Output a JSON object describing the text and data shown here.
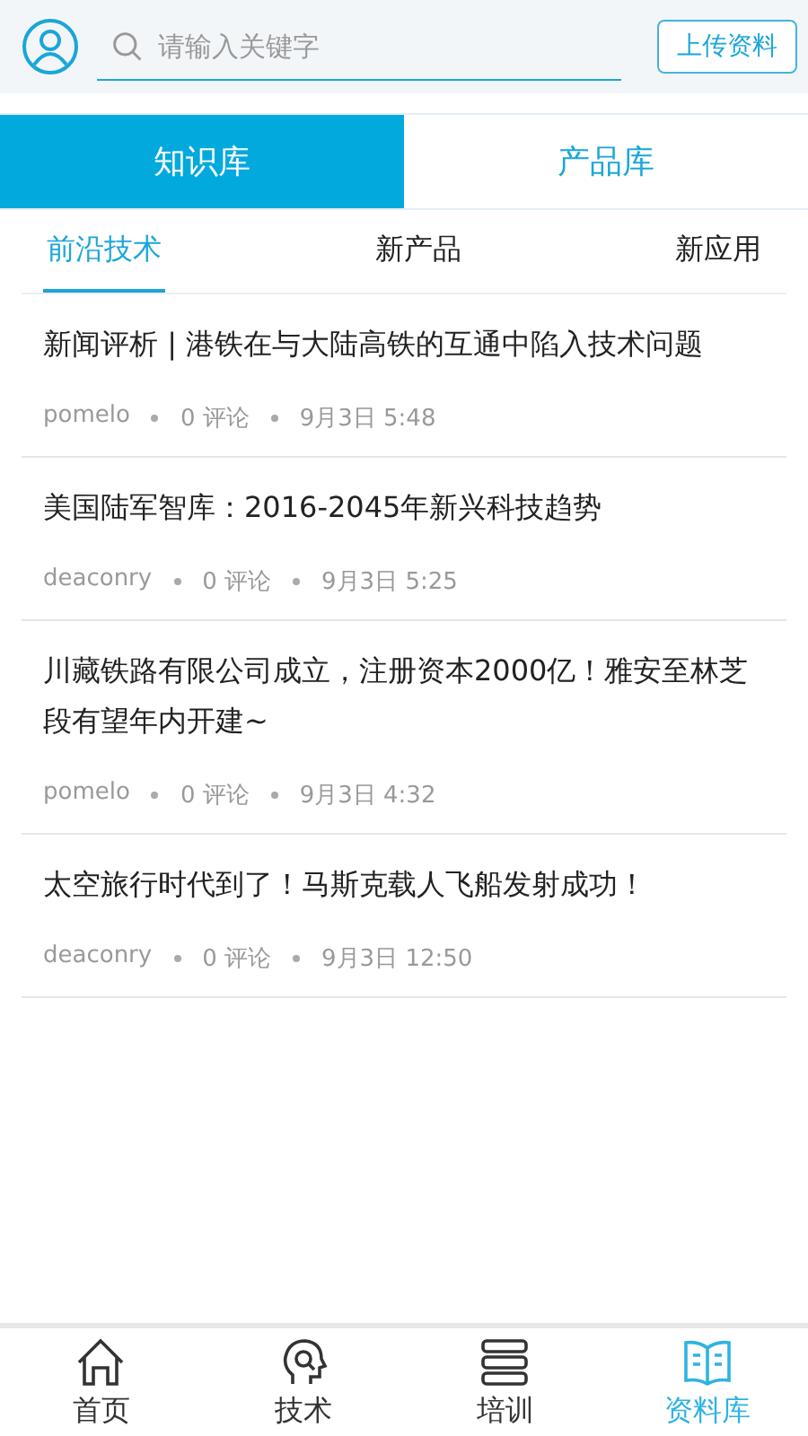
{
  "header": {
    "search": {
      "placeholder": "请输入关键字"
    },
    "upload_button": "上传资料"
  },
  "tabs": [
    {
      "label": "知识库",
      "selected": true
    },
    {
      "label": "产品库",
      "selected": false
    }
  ],
  "subtabs": [
    {
      "label": "前沿技术",
      "selected": true
    },
    {
      "label": "新产品",
      "selected": false
    },
    {
      "label": "新应用",
      "selected": false
    }
  ],
  "articles": [
    {
      "title": "新闻评析 | 港铁在与大陆高铁的互通中陷入技术问题",
      "author": "pomelo",
      "comments": "0 评论",
      "time": "9月3日 5:48"
    },
    {
      "title": "美国陆军智库：2016-2045年新兴科技趋势",
      "author": "deaconry",
      "comments": "0 评论",
      "time": "9月3日 5:25"
    },
    {
      "title": "川藏铁路有限公司成立，注册资本2000亿！雅安至林芝段有望年内开建~",
      "author": "pomelo",
      "comments": "0 评论",
      "time": "9月3日 4:32"
    },
    {
      "title": "太空旅行时代到了！马斯克载人飞船发射成功！",
      "author": "deaconry",
      "comments": "0 评论",
      "time": "9月3日 12:50"
    }
  ],
  "bottom_nav": [
    {
      "kind": "home",
      "label": "首页",
      "selected": false
    },
    {
      "kind": "tech",
      "label": "技术",
      "selected": false
    },
    {
      "kind": "training",
      "label": "培训",
      "selected": false
    },
    {
      "kind": "library",
      "label": "资料库",
      "selected": true
    }
  ]
}
